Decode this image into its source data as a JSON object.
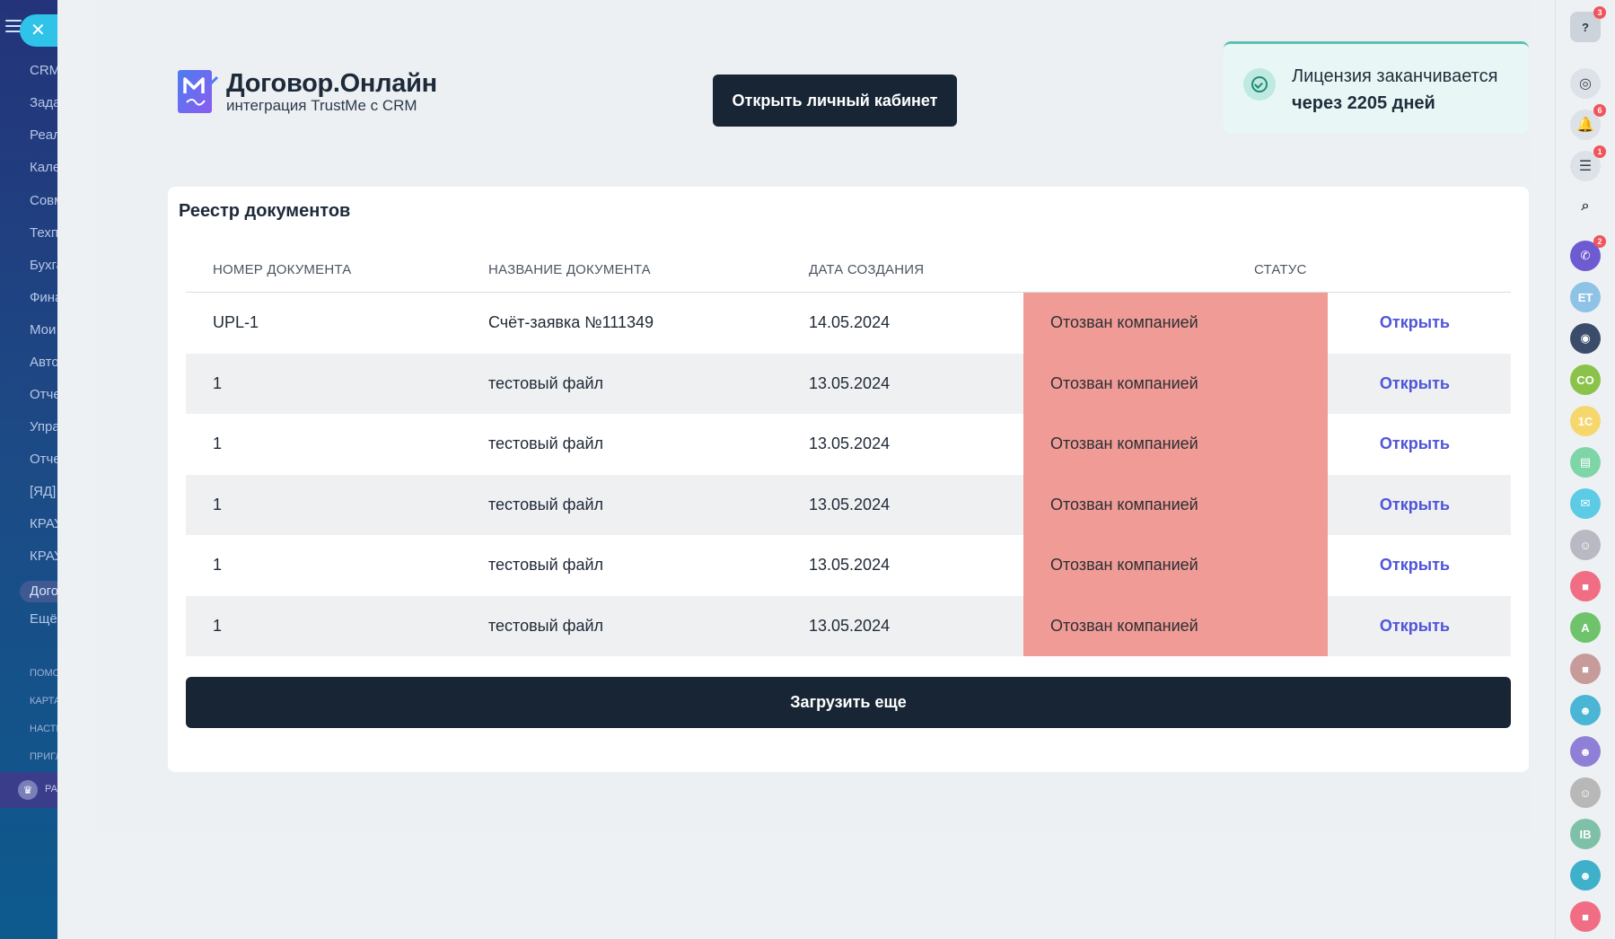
{
  "left_sidebar": {
    "close_icon": "✕",
    "items": [
      {
        "label": "CRM"
      },
      {
        "label": "Задачи"
      },
      {
        "label": "Реализация"
      },
      {
        "label": "Календарь"
      },
      {
        "label": "Совместная"
      },
      {
        "label": "Техподдержка"
      },
      {
        "label": "Бухгалтерия"
      },
      {
        "label": "Финансы"
      },
      {
        "label": "Мои"
      },
      {
        "label": "Автоматизация"
      },
      {
        "label": "Отчеты"
      },
      {
        "label": "Управление"
      },
      {
        "label": "Отчеты"
      },
      {
        "label": "[ЯД]"
      },
      {
        "label": "КРАУ"
      },
      {
        "label": "КРАУ"
      },
      {
        "label": "Договор"
      },
      {
        "label": "Ещё"
      }
    ],
    "footer_items": [
      {
        "label": "ПОМОЩЬ"
      },
      {
        "label": "КАРТА"
      },
      {
        "label": "НАСТРОЙКИ"
      },
      {
        "label": "ПРИГЛАСИТЬ"
      }
    ],
    "plan_label": "РА",
    "crown_icon": "♛"
  },
  "header": {
    "logo_title": "Договор.Онлайн",
    "logo_subtitle": "интеграция TrustMe с CRM",
    "open_cabinet_label": "Открыть личный кабинет",
    "license_line1": "Лицензия заканчивается",
    "license_line2": "через 2205 дней"
  },
  "registry": {
    "title": "Реестр документов",
    "columns": {
      "number": "НОМЕР ДОКУМЕНТА",
      "name": "НАЗВАНИЕ ДОКУМЕНТА",
      "date": "ДАТА СОЗДАНИЯ",
      "status": "СТАТУС"
    },
    "rows": [
      {
        "number": "UPL-1",
        "name": "Счёт-заявка №111349",
        "date": "14.05.2024",
        "status": "Отозван компанией",
        "action": "Открыть"
      },
      {
        "number": "1",
        "name": "тестовый файл",
        "date": "13.05.2024",
        "status": "Отозван компанией",
        "action": "Открыть"
      },
      {
        "number": "1",
        "name": "тестовый файл",
        "date": "13.05.2024",
        "status": "Отозван компанией",
        "action": "Открыть"
      },
      {
        "number": "1",
        "name": "тестовый файл",
        "date": "13.05.2024",
        "status": "Отозван компанией",
        "action": "Открыть"
      },
      {
        "number": "1",
        "name": "тестовый файл",
        "date": "13.05.2024",
        "status": "Отозван компанией",
        "action": "Открыть"
      },
      {
        "number": "1",
        "name": "тестовый файл",
        "date": "13.05.2024",
        "status": "Отозван компанией",
        "action": "Открыть"
      }
    ],
    "load_more_label": "Загрузить еще"
  },
  "right_bar": {
    "items": [
      {
        "name": "help-icon",
        "glyph": "?",
        "badge": "3"
      },
      {
        "name": "copilot-icon",
        "glyph": "◎",
        "badge": ""
      },
      {
        "name": "bell-icon",
        "glyph": "🔔",
        "badge": "6"
      },
      {
        "name": "tasks-icon",
        "glyph": "☰",
        "badge": "1"
      },
      {
        "name": "search-icon",
        "glyph": "⌕",
        "badge": ""
      },
      {
        "name": "phone-icon",
        "glyph": "✆",
        "badge": "2"
      },
      {
        "name": "avatar-et",
        "glyph": "ET",
        "badge": ""
      },
      {
        "name": "chatbot-icon",
        "glyph": "◉",
        "badge": ""
      },
      {
        "name": "avatar-co",
        "glyph": "CO",
        "badge": ""
      },
      {
        "name": "app-1c-icon",
        "glyph": "1С",
        "badge": ""
      },
      {
        "name": "notes-icon",
        "glyph": "▤",
        "badge": ""
      },
      {
        "name": "chat-icon",
        "glyph": "✉",
        "badge": ""
      },
      {
        "name": "avatar-photo-1",
        "glyph": "☺",
        "badge": ""
      },
      {
        "name": "video-icon",
        "glyph": "■",
        "badge": ""
      },
      {
        "name": "avatar-a",
        "glyph": "A",
        "badge": ""
      },
      {
        "name": "video-icon-2",
        "glyph": "■",
        "badge": ""
      },
      {
        "name": "group-icon",
        "glyph": "☻",
        "badge": ""
      },
      {
        "name": "group-icon-2",
        "glyph": "☻",
        "badge": ""
      },
      {
        "name": "avatar-photo-2",
        "glyph": "☺",
        "badge": ""
      },
      {
        "name": "avatar-ib",
        "glyph": "IB",
        "badge": ""
      },
      {
        "name": "group-icon-3",
        "glyph": "☻",
        "badge": ""
      },
      {
        "name": "video-icon-3",
        "glyph": "■",
        "badge": ""
      }
    ],
    "colors": [
      "#cdd3da",
      "#dde2e8",
      "#dde2e8",
      "#dde2e8",
      "#eef1f4",
      "#6f5bd1",
      "#8fc3e6",
      "#3b4c6b",
      "#8bc34a",
      "#f5d76e",
      "#7ed6a8",
      "#5ccbe6",
      "#b9b9c4",
      "#f06d84",
      "#6fc36b",
      "#c89b9b",
      "#4bb5d6",
      "#8f7fd6",
      "#b8b8b8",
      "#7fc1a8",
      "#3fb0c9",
      "#f06d84"
    ]
  },
  "colors": {
    "status_bg": "#f09b96",
    "primary_dark": "#172535",
    "link": "#4f55d9",
    "license_bg": "#e8f7f5"
  }
}
